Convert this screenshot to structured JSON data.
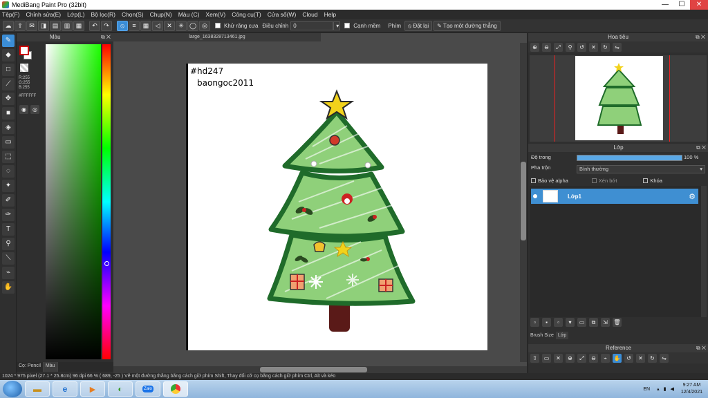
{
  "window": {
    "title": "MediBang Paint Pro (32bit)",
    "controls": [
      "minimize",
      "maximize",
      "close"
    ]
  },
  "menu": [
    "Tệp(F)",
    "Chỉnh sửa(E)",
    "Lớp(L)",
    "Bộ lọc(R)",
    "Chọn(S)",
    "Chụp(N)",
    "Màu (C)",
    "Xem(V)",
    "Công cụ(T)",
    "Cửa sổ(W)",
    "Cloud",
    "Help"
  ],
  "toolbar": {
    "antialias_label": "Khử răng cưa",
    "adjust_label": "Điều chỉnh",
    "adjust_value": "0",
    "edge_label": "Cạnh mềm",
    "key_label": "Phím",
    "reset_label": "Đặt lại",
    "straight_line_label": "Tạo một đường thẳng"
  },
  "color_panel": {
    "title": "Màu",
    "rgb_text": "R:255 G:255 B:255",
    "hex": "#FFFFFF",
    "tabs": [
      "Cọ: Pencil",
      "Màu"
    ]
  },
  "document": {
    "tab": "large_1638328713461.jpg",
    "text_line1": "#hd247",
    "text_line2": "baongoc2011"
  },
  "navigator": {
    "title": "Hoa tiêu"
  },
  "layers": {
    "title": "Lớp",
    "opacity_label": "Độ trong",
    "opacity_value": "100 %",
    "blend_label": "Pha trộn",
    "blend_value": "Bình thường",
    "protect_alpha": "Bảo vệ alpha",
    "clip": "Xén bớt",
    "lock": "Khóa",
    "items": [
      {
        "name": "Lớp1"
      }
    ],
    "bottom_tabs": [
      "Brush Size",
      "Lớp"
    ]
  },
  "reference": {
    "title": "Reference"
  },
  "status": {
    "text": "1024 * 975 pixel   (27.1 * 25.8cm)   96 dpi   66 %   ( 689, -25 )   Vẽ một đường thẳng bằng cách giữ phím Shift, Thay đổi cỡ cọ bằng cách giữ phím Ctrl, Alt và kéo"
  },
  "taskbar": {
    "apps": [
      "start",
      "explorer",
      "ie",
      "media-player",
      "app-green",
      "zalo",
      "chrome"
    ],
    "zalo_label": "Zalo",
    "lang": "EN",
    "time": "9:27 AM",
    "date": "12/4/2021"
  },
  "colors": {
    "accent": "#3b8dd6",
    "tree_green": "#1f6b2a",
    "tree_fill": "#86c96f",
    "trunk": "#5a1a18",
    "star": "#f2d21b"
  }
}
